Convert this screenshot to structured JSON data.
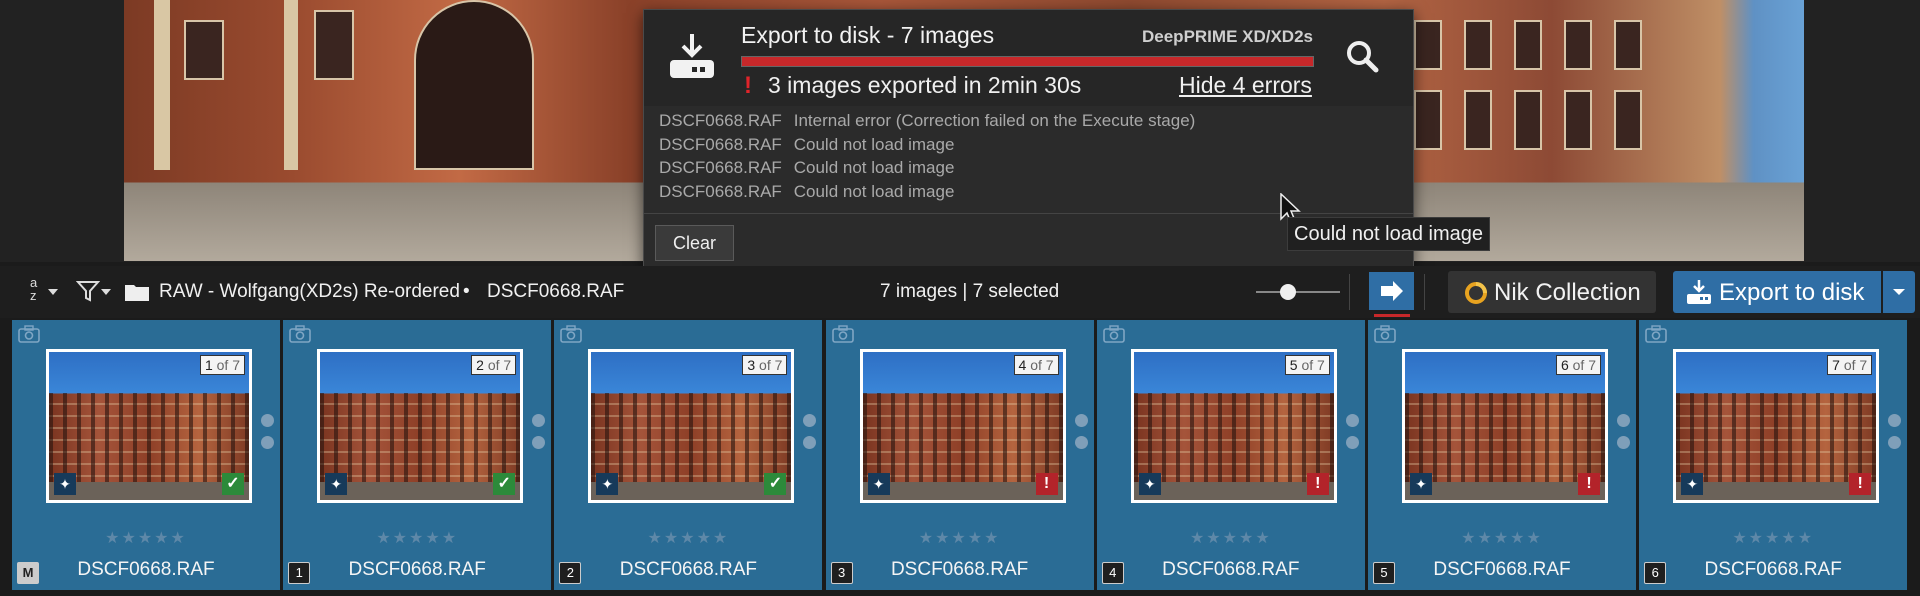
{
  "popup": {
    "title": "Export to disk - 7 images",
    "engine": "DeepPRIME XD/XD2s",
    "progress_fraction": 1.0,
    "progress_color": "#c7282a",
    "status": "3 images exported in 2min 30s",
    "hide_errors": "Hide 4 errors",
    "errors": [
      {
        "file": "DSCF0668.RAF",
        "message": "Internal error (Correction failed on the Execute stage)"
      },
      {
        "file": "DSCF0668.RAF",
        "message": "Could not load image"
      },
      {
        "file": "DSCF0668.RAF",
        "message": "Could not load image"
      },
      {
        "file": "DSCF0668.RAF",
        "message": "Could not load image"
      }
    ],
    "clear_label": "Clear"
  },
  "tooltip": "Could not load image",
  "toolbar": {
    "sort_label": "a z",
    "folder": "RAW - Wolfgang(XD2s) Re-ordered",
    "separator": "•",
    "file": "DSCF0668.RAF",
    "selection_info": "7 images | 7 selected",
    "zoom_fraction": 0.35,
    "nik_label": "Nik Collection",
    "export_label": "Export to disk"
  },
  "colors": {
    "accent_blue": "#2f6ea5",
    "thumb_selected": "#2a6c95",
    "error_red": "#c7282a",
    "ok_green": "#2c8a3a"
  },
  "thumbnails": [
    {
      "index": "1",
      "of": "of 7",
      "name": "DSCF0668.RAF",
      "tag": "M",
      "status": "ok",
      "stars": "★★★★★",
      "rating": 0
    },
    {
      "index": "2",
      "of": "of 7",
      "name": "DSCF0668.RAF",
      "tag": "1",
      "status": "ok",
      "stars": "★★★★★",
      "rating": 0
    },
    {
      "index": "3",
      "of": "of 7",
      "name": "DSCF0668.RAF",
      "tag": "2",
      "status": "ok",
      "stars": "★★★★★",
      "rating": 0
    },
    {
      "index": "4",
      "of": "of 7",
      "name": "DSCF0668.RAF",
      "tag": "3",
      "status": "error",
      "stars": "★★★★★",
      "rating": 0
    },
    {
      "index": "5",
      "of": "of 7",
      "name": "DSCF0668.RAF",
      "tag": "4",
      "status": "error",
      "stars": "★★★★★",
      "rating": 0
    },
    {
      "index": "6",
      "of": "of 7",
      "name": "DSCF0668.RAF",
      "tag": "5",
      "status": "error",
      "stars": "★★★★★",
      "rating": 0
    },
    {
      "index": "7",
      "of": "of 7",
      "name": "DSCF0668.RAF",
      "tag": "6",
      "status": "error",
      "stars": "★★★★★",
      "rating": 0
    }
  ]
}
